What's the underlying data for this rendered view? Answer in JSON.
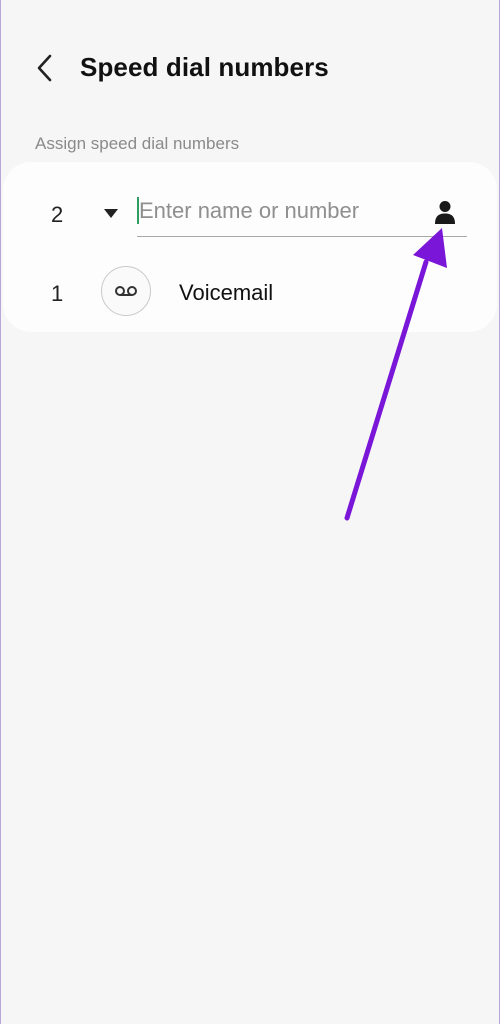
{
  "header": {
    "title": "Speed dial numbers",
    "back_icon": "chevron-left-icon"
  },
  "section": {
    "label": "Assign speed dial numbers"
  },
  "assign_row": {
    "slot_number": "2",
    "dropdown_icon": "caret-down-icon",
    "input_value": "",
    "input_placeholder": "Enter name or number",
    "contact_icon": "person-icon"
  },
  "voicemail_row": {
    "slot_number": "1",
    "icon": "voicemail-icon",
    "label": "Voicemail"
  },
  "colors": {
    "background": "#f6f6f6",
    "card": "#fdfdfd",
    "caret": "#2f9e63",
    "annotation_arrow": "#7a16d8"
  }
}
